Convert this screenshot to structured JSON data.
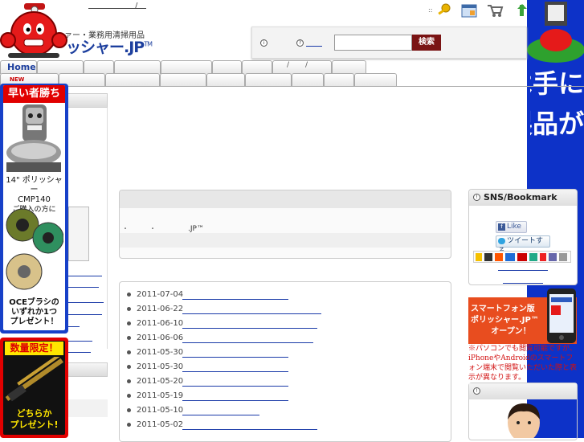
{
  "header": {
    "site_sub": "ァー・業務用清掃用品",
    "site_title": "ッシャー.JP",
    "site_title_tm": "TM",
    "top_slash": "/"
  },
  "search": {
    "button_label": "検索",
    "placeholder": ""
  },
  "nav": {
    "home_label": "Home",
    "new_label": "NEW"
  },
  "left_banner": {
    "headline": "早い者勝ち",
    "product_line1": "14\" ポリッシャー",
    "product_line2": "CMP140",
    "product_line3": "ご購入の方に",
    "promo_line1": "OCEブラシの",
    "promo_line2": "いずれか1つ",
    "promo_line3": "プレゼント！"
  },
  "left_banner2": {
    "headline": "数量限定！",
    "line1": "どちらか",
    "line2": "プレゼント!"
  },
  "main": {
    "bullet_dot": "・",
    "body_text": ".JP™"
  },
  "news": [
    {
      "date": "2011-07-04"
    },
    {
      "date": "2011-06-22"
    },
    {
      "date": "2011-06-10"
    },
    {
      "date": "2011-06-06"
    },
    {
      "date": "2011-05-30"
    },
    {
      "date": "2011-05-30"
    },
    {
      "date": "2011-05-20"
    },
    {
      "date": "2011-05-19"
    },
    {
      "date": "2011-05-10"
    },
    {
      "date": "2011-05-02"
    }
  ],
  "sns": {
    "title": "SNS/Bookmark",
    "like_label": "Like",
    "tweet_label": "ツイートする"
  },
  "smartphone": {
    "banner_line1": "スマートフォン版",
    "banner_line2": "ポリッシャー.JP™",
    "banner_line3": "オープン！",
    "note": "※パソコンでも閲覧可能ですが、iPhoneやAndroidのスマートフォン端末で閲覧いただいた際と表示が異なります。"
  },
  "right_banner": {
    "text_col1": "他では手に",
    "text_col2": "製品が"
  },
  "colors": {
    "brand_blue": "#1d3f9e",
    "banner_blue": "#0d32c8",
    "alert_red": "#e10000",
    "search_btn": "#7a1414"
  }
}
